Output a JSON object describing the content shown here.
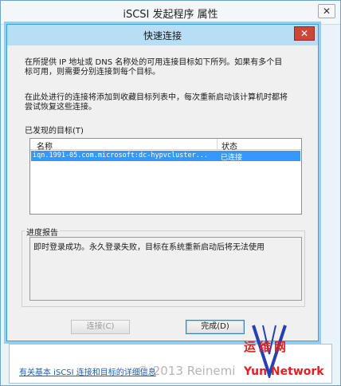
{
  "outer_window": {
    "title": "iSCSI 发起程序 属性",
    "close_glyph": "✕",
    "help_link": "有关基本 iSCSI 连接和目标的详细信息"
  },
  "dialog": {
    "title": "快速连接",
    "close_glyph": "✕",
    "intro_line1": "在所提供 IP 地址或 DNS 名称处的可用连接目标如下所列。如果有多个目",
    "intro_line2": "标可用，则需要分别连接到每个目标。",
    "note_line1": "在此处进行的连接将添加到收藏目标列表中，每次重新启动该计算机时都将",
    "note_line2": "尝试恢复这些连接。",
    "targets_group_label": "已发现的目标(T)",
    "columns": [
      "名称",
      "状态"
    ],
    "targets": [
      {
        "name": "iqn.1991-05.com.microsoft:dc-hypvcluster...",
        "status": "已连接",
        "selected": true
      }
    ],
    "report_group_label": "进度报告",
    "report_text": "即时登录成功。永久登录失败，目标在系统重新启动后将无法使用",
    "connect_button": "连接(C)",
    "done_button": "完成(D)"
  },
  "watermark": "© 2013 Reinemi",
  "logo": {
    "cn": "运维网",
    "en": "Yun Network"
  },
  "colors": {
    "selection": "#3399ff",
    "dialog_border": "#3aa0d8",
    "close_red": "#c9483a",
    "link": "#1f5fae",
    "logo_red": "#dd2222"
  }
}
